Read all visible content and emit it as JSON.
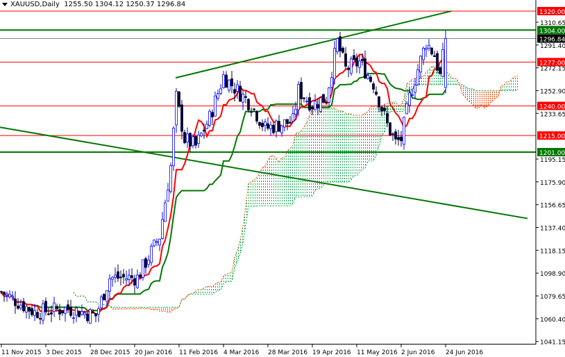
{
  "header": {
    "symbol": "XAUUSD,Daily",
    "open": "1255.50",
    "high": "1304.12",
    "low": "1250.37",
    "close": "1296.84"
  },
  "colors": {
    "bull": "#0000ff",
    "bear": "#000033",
    "tenkan": "#ff0000",
    "kijun": "#007700",
    "cloud_up": "#00aa44",
    "cloud_down": "#ff4400",
    "level_red": "#ff0000",
    "level_green": "#007700",
    "trend": "#007700",
    "current": "#000000"
  },
  "chart_data": {
    "type": "candlestick",
    "title": "XAUUSD,Daily",
    "ylim": [
      1041.15,
      1330
    ],
    "y_ticks": [
      "1310.65",
      "1291.40",
      "1272.15",
      "1252.90",
      "1233.65",
      "1195.15",
      "1175.90",
      "1156.65",
      "1137.40",
      "1118.15",
      "1098.90",
      "1079.65",
      "1060.40",
      "1041.15"
    ],
    "x_ticks": [
      {
        "bar": 0,
        "label": "11 Nov 2015"
      },
      {
        "bar": 16,
        "label": "3 Dec 2015"
      },
      {
        "bar": 32,
        "label": "28 Dec 2015"
      },
      {
        "bar": 48,
        "label": "20 Jan 2016"
      },
      {
        "bar": 64,
        "label": "11 Feb 2016"
      },
      {
        "bar": 80,
        "label": "4 Mar 2016"
      },
      {
        "bar": 96,
        "label": "28 Mar 2016"
      },
      {
        "bar": 112,
        "label": "19 Apr 2016"
      },
      {
        "bar": 128,
        "label": "11 May 2016"
      },
      {
        "bar": 144,
        "label": "2 Jun 2016"
      },
      {
        "bar": 160,
        "label": "24 Jun 2016"
      }
    ],
    "price_path": [
      [
        0,
        1083
      ],
      [
        12,
        1066
      ],
      [
        24,
        1069
      ],
      [
        34,
        1063
      ],
      [
        39,
        1095
      ],
      [
        49,
        1095
      ],
      [
        57,
        1130
      ],
      [
        61,
        1189
      ],
      [
        63,
        1247
      ],
      [
        66,
        1212
      ],
      [
        70,
        1206
      ],
      [
        75,
        1230
      ],
      [
        80,
        1265
      ],
      [
        85,
        1253
      ],
      [
        90,
        1241
      ],
      [
        95,
        1221
      ],
      [
        100,
        1224
      ],
      [
        105,
        1227
      ],
      [
        107,
        1253
      ],
      [
        112,
        1241
      ],
      [
        117,
        1247
      ],
      [
        121,
        1294
      ],
      [
        124,
        1271
      ],
      [
        129,
        1277
      ],
      [
        134,
        1259
      ],
      [
        139,
        1224
      ],
      [
        142,
        1209
      ],
      [
        144,
        1212
      ],
      [
        147,
        1247
      ],
      [
        150,
        1271
      ],
      [
        153,
        1294
      ],
      [
        156,
        1283
      ],
      [
        158,
        1265
      ],
      [
        160,
        1296.84
      ]
    ],
    "levels": [
      {
        "price": 1320.0,
        "label": "1320.00",
        "color": "red"
      },
      {
        "price": 1304.0,
        "label": "1304.00",
        "color": "green"
      },
      {
        "price": 1296.84,
        "label": "1296.84",
        "color": "current"
      },
      {
        "price": 1277.0,
        "label": "1277.00",
        "color": "red"
      },
      {
        "price": 1240.0,
        "label": "1240.00",
        "color": "red"
      },
      {
        "price": 1215.0,
        "label": "1215.00",
        "color": "red"
      },
      {
        "price": 1201.0,
        "label": "1201.00",
        "color": "green"
      }
    ],
    "trendlines": [
      {
        "from": [
          62.75,
          1263.7
        ],
        "to": [
          162,
          1320
        ]
      },
      {
        "from": [
          -0.5,
          1222
        ],
        "to": [
          189.5,
          1145
        ]
      }
    ],
    "indicator": "Ichimoku Kinko Hyo (9, 26, 52)"
  }
}
